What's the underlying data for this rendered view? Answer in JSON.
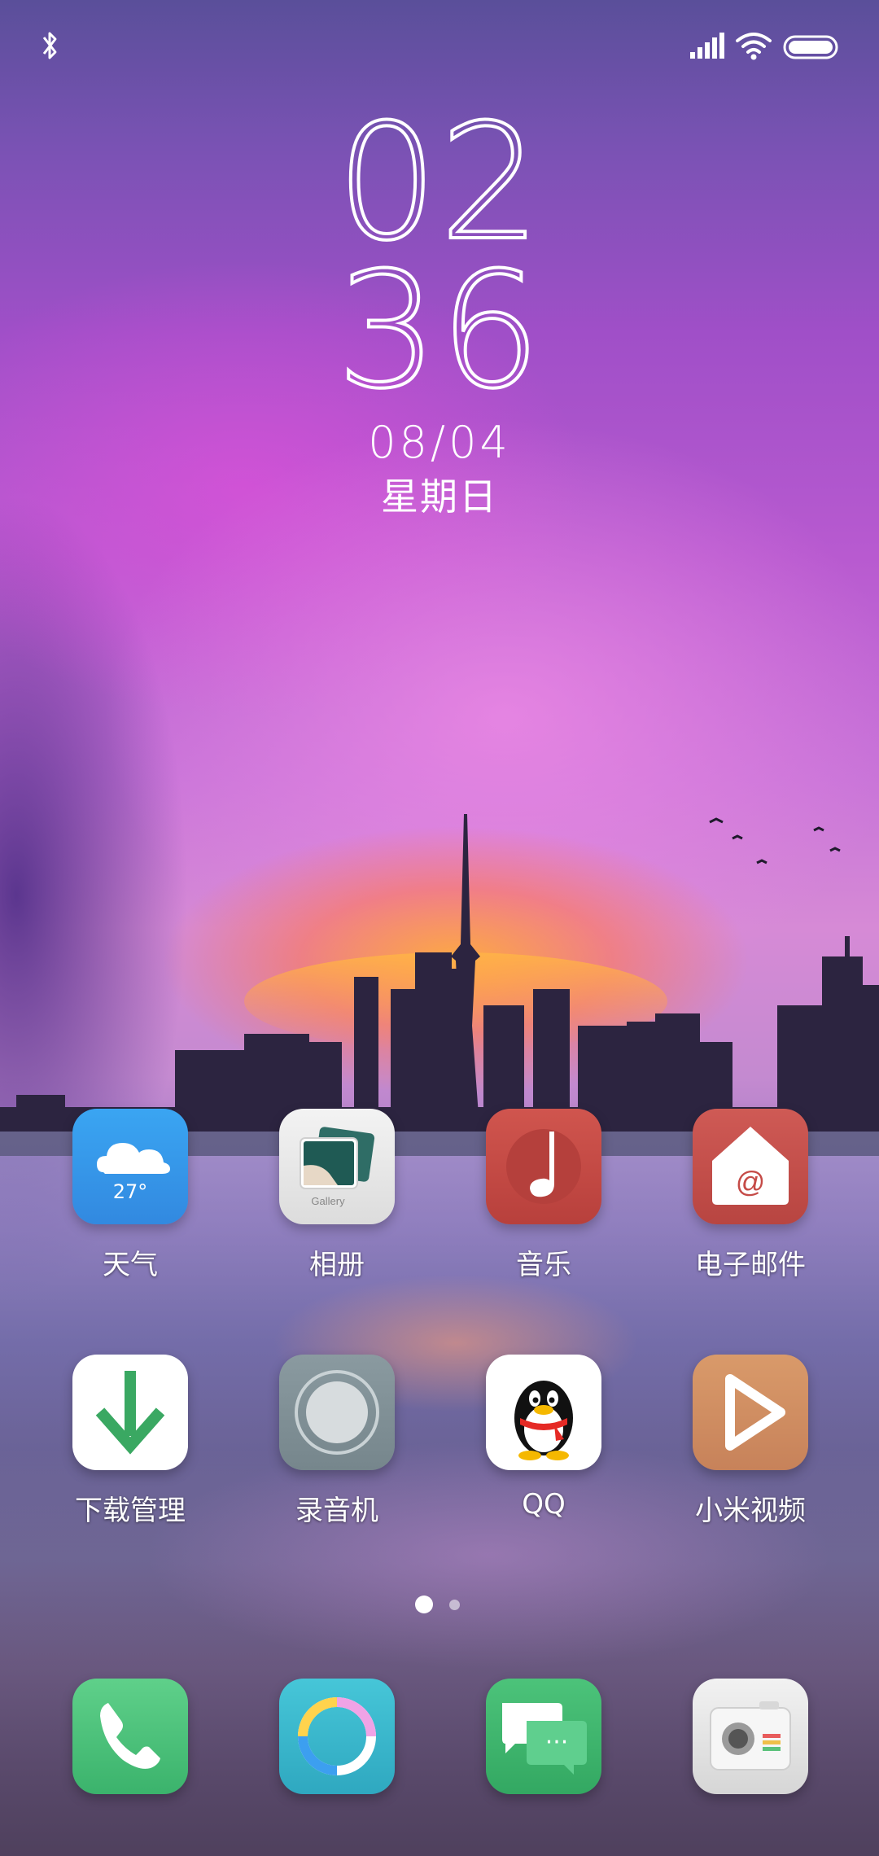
{
  "status_bar": {
    "bluetooth_icon": "bluetooth-icon",
    "signal_icon": "signal-bars-icon",
    "wifi_icon": "wifi-icon",
    "battery_icon": "battery-icon"
  },
  "clock": {
    "hours": "02",
    "minutes": "36",
    "date": "08/04",
    "weekday": "星期日"
  },
  "apps": [
    {
      "label": "天气",
      "icon": "weather-cloud-icon",
      "temperature": "27°",
      "color": "#3aa5f2"
    },
    {
      "label": "相册",
      "icon": "gallery-icon",
      "caption": "Gallery",
      "color": "#e8e8e8"
    },
    {
      "label": "音乐",
      "icon": "music-note-icon",
      "color": "#c84a45"
    },
    {
      "label": "电子邮件",
      "icon": "mail-house-icon",
      "symbol": "@",
      "color": "#c84f4b"
    },
    {
      "label": "下载管理",
      "icon": "download-arrow-icon",
      "color": "#3aa862"
    },
    {
      "label": "录音机",
      "icon": "recorder-icon",
      "color": "#7f8f95"
    },
    {
      "label": "QQ",
      "icon": "qq-penguin-icon",
      "color": "#ffffff"
    },
    {
      "label": "小米视频",
      "icon": "video-play-icon",
      "color": "#d08e62"
    }
  ],
  "dock": [
    {
      "icon": "phone-icon",
      "color": "#4cc27c"
    },
    {
      "icon": "browser-ring-icon",
      "color": "#3ab8cc"
    },
    {
      "icon": "messages-icon",
      "color": "#40b86e",
      "symbol": "···"
    },
    {
      "icon": "camera-icon",
      "color": "#e6e6e6"
    }
  ],
  "page_indicator": {
    "pages": 2,
    "current": 1
  }
}
